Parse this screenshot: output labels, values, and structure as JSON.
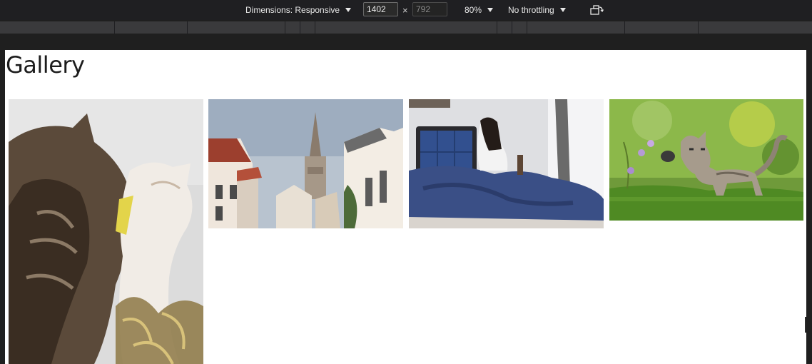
{
  "toolbar": {
    "dimensions_label": "Dimensions: Responsive",
    "width_value": "1402",
    "height_value": "792",
    "times_sign": "×",
    "zoom_label": "80%",
    "throttling_label": "No throttling",
    "rotate_icon": "rotate-icon",
    "caret_icon": "caret-down-icon"
  },
  "page": {
    "title": "Gallery",
    "images": [
      {
        "subject": "two cats nuzzling",
        "icon": "photo-cats"
      },
      {
        "subject": "church spire between buildings",
        "icon": "photo-city"
      },
      {
        "subject": "woman sitting on bed",
        "icon": "photo-bedroom"
      },
      {
        "subject": "kitten playing in grass",
        "icon": "photo-kitten"
      }
    ]
  },
  "colors": {
    "devtools_bg": "#1f1f22",
    "media_bar": "#3a3a3c",
    "viewport_bg": "#ffffff",
    "title_text": "#1c1c1c"
  }
}
